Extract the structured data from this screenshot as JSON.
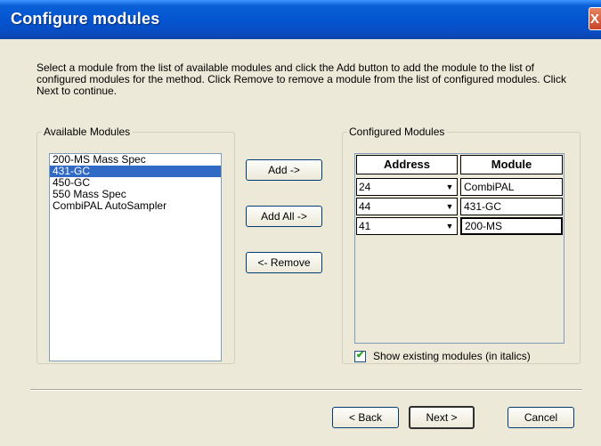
{
  "window": {
    "title": "Configure modules",
    "close_glyph": "X"
  },
  "instructions": "Select a module from the list of available modules and click the Add button to add the module to the list of configured modules for the method. Click Remove to remove a module from the list of configured modules. Click Next to continue.",
  "available": {
    "label": "Available Modules",
    "items": [
      {
        "label": "200-MS Mass Spec",
        "selected": false
      },
      {
        "label": "431-GC",
        "selected": true
      },
      {
        "label": "450-GC",
        "selected": false
      },
      {
        "label": "550 Mass Spec",
        "selected": false
      },
      {
        "label": "CombiPAL AutoSampler",
        "selected": false
      }
    ]
  },
  "buttons": {
    "add": "Add ->",
    "add_all": "Add All ->",
    "remove": "<- Remove",
    "back": "< Back",
    "next": "Next >",
    "cancel": "Cancel"
  },
  "configured": {
    "label": "Configured Modules",
    "headers": {
      "address": "Address",
      "module": "Module"
    },
    "rows": [
      {
        "address": "24",
        "module": "CombiPAL"
      },
      {
        "address": "44",
        "module": "431-GC"
      },
      {
        "address": "41",
        "module": "200-MS"
      }
    ],
    "show_existing_label": "Show existing modules (in italics)",
    "show_existing_checked": true
  },
  "icons": {
    "dropdown": "chevron-down-icon",
    "close": "close-icon",
    "check": "checkmark-icon"
  }
}
